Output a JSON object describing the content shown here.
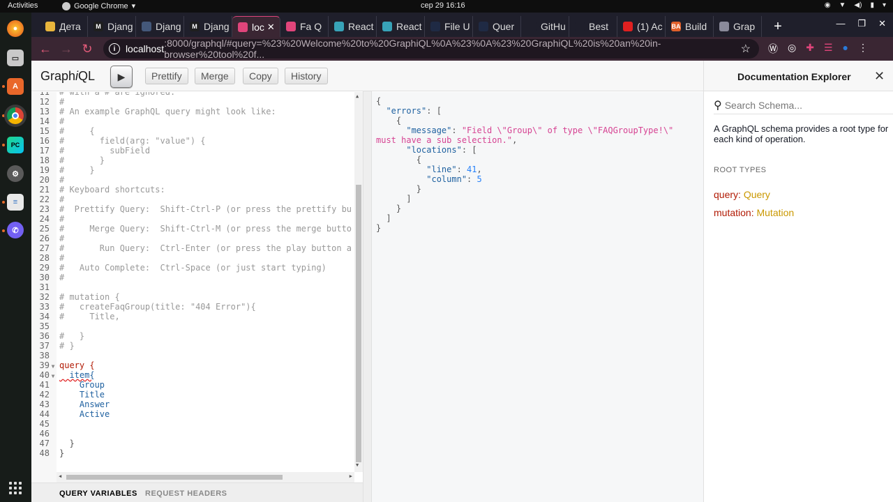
{
  "system": {
    "activities": "Activities",
    "app": "Google Chrome",
    "clock": "сер 29  16:16"
  },
  "tabs": [
    {
      "label": "Дета",
      "color": "#e8b53c"
    },
    {
      "label": "Djang",
      "color": "#1f1f1f",
      "icon": "M"
    },
    {
      "label": "Djang",
      "color": "#44587a"
    },
    {
      "label": "Djang",
      "color": "#1f1f1f",
      "icon": "M"
    },
    {
      "label": "loc",
      "color": "#e0457b",
      "active": true
    },
    {
      "label": "Fa Q",
      "color": "#e0457b"
    },
    {
      "label": "React",
      "color": "#38a3b8"
    },
    {
      "label": "React",
      "color": "#38a3b8"
    },
    {
      "label": "File U",
      "color": "#1f2a44"
    },
    {
      "label": "Quer",
      "color": "#1f2a44"
    },
    {
      "label": "GitHu",
      "color": "#1f1f2b"
    },
    {
      "label": "Best",
      "color": "#1f1f2b"
    },
    {
      "label": "(1) Ac",
      "color": "#e02020"
    },
    {
      "label": "Build",
      "color": "#e0602a",
      "icon": "BA"
    },
    {
      "label": "Grap",
      "color": "#8a8a9a"
    }
  ],
  "url": {
    "host": "localhost",
    "path": ":8000/graphql/#query=%23%20Welcome%20to%20GraphiQL%0A%23%0A%23%20GraphiQL%20is%20an%20in-browser%20tool%20f..."
  },
  "graphiql": {
    "logo_pre": "Graph",
    "logo_i": "i",
    "logo_post": "QL",
    "prettify": "Prettify",
    "merge": "Merge",
    "copy": "Copy",
    "history": "History",
    "query_variables": "QUERY VARIABLES",
    "request_headers": "REQUEST HEADERS"
  },
  "editor_lines": [
    {
      "n": "11",
      "t": "# with a # are ignored.",
      "c": "cm"
    },
    {
      "n": "12",
      "t": "#",
      "c": "cm"
    },
    {
      "n": "13",
      "t": "# An example GraphQL query might look like:",
      "c": "cm"
    },
    {
      "n": "14",
      "t": "#",
      "c": "cm"
    },
    {
      "n": "15",
      "t": "#     {",
      "c": "cm"
    },
    {
      "n": "16",
      "t": "#       field(arg: \"value\") {",
      "c": "cm"
    },
    {
      "n": "17",
      "t": "#         subField",
      "c": "cm"
    },
    {
      "n": "18",
      "t": "#       }",
      "c": "cm"
    },
    {
      "n": "19",
      "t": "#     }",
      "c": "cm"
    },
    {
      "n": "20",
      "t": "#",
      "c": "cm"
    },
    {
      "n": "21",
      "t": "# Keyboard shortcuts:",
      "c": "cm"
    },
    {
      "n": "22",
      "t": "#",
      "c": "cm"
    },
    {
      "n": "23",
      "t": "#  Prettify Query:  Shift-Ctrl-P (or press the prettify bu",
      "c": "cm"
    },
    {
      "n": "24",
      "t": "#",
      "c": "cm"
    },
    {
      "n": "25",
      "t": "#     Merge Query:  Shift-Ctrl-M (or press the merge butto",
      "c": "cm"
    },
    {
      "n": "26",
      "t": "#",
      "c": "cm"
    },
    {
      "n": "27",
      "t": "#       Run Query:  Ctrl-Enter (or press the play button a",
      "c": "cm"
    },
    {
      "n": "28",
      "t": "#",
      "c": "cm"
    },
    {
      "n": "29",
      "t": "#   Auto Complete:  Ctrl-Space (or just start typing)",
      "c": "cm"
    },
    {
      "n": "30",
      "t": "#",
      "c": "cm"
    },
    {
      "n": "31",
      "t": "",
      "c": "cm"
    },
    {
      "n": "32",
      "t": "# mutation {",
      "c": "cm"
    },
    {
      "n": "33",
      "t": "#   createFaqGroup(title: \"404 Error\"){",
      "c": "cm"
    },
    {
      "n": "34",
      "t": "#     Title,",
      "c": "cm"
    },
    {
      "n": "35",
      "t": "",
      "c": "cm"
    },
    {
      "n": "36",
      "t": "#   }",
      "c": "cm"
    },
    {
      "n": "37",
      "t": "# }",
      "c": "cm"
    },
    {
      "n": "38",
      "t": "",
      "c": "cm"
    },
    {
      "n": "39",
      "t": "query {",
      "c": "kw",
      "fold": true
    },
    {
      "n": "40",
      "t": "  item{",
      "c": "fld",
      "fold": true
    },
    {
      "n": "41",
      "t": "    Group",
      "c": "fld"
    },
    {
      "n": "42",
      "t": "    Title",
      "c": "fld"
    },
    {
      "n": "43",
      "t": "    Answer",
      "c": "fld"
    },
    {
      "n": "44",
      "t": "    Active",
      "c": "fld"
    },
    {
      "n": "45",
      "t": "",
      "c": "fld"
    },
    {
      "n": "46",
      "t": "",
      "c": "fld"
    },
    {
      "n": "47",
      "t": "  }",
      "c": "pun"
    },
    {
      "n": "48",
      "t": "}",
      "c": "pun"
    }
  ],
  "result_lines": [
    [
      {
        "t": "{",
        "c": "pun"
      }
    ],
    [
      {
        "t": "  \"errors\"",
        "c": "key"
      },
      {
        "t": ": [",
        "c": "pun"
      }
    ],
    [
      {
        "t": "    {",
        "c": "pun"
      }
    ],
    [
      {
        "t": "      \"message\"",
        "c": "key"
      },
      {
        "t": ": ",
        "c": "pun"
      },
      {
        "t": "\"Field \\\"Group\\\" of type \\\"FAQGroupType!\\\"",
        "c": "str"
      }
    ],
    [
      {
        "t": "must have a sub selection.\"",
        "c": "str"
      },
      {
        "t": ",",
        "c": "pun"
      }
    ],
    [
      {
        "t": "      \"locations\"",
        "c": "key"
      },
      {
        "t": ": [",
        "c": "pun"
      }
    ],
    [
      {
        "t": "        {",
        "c": "pun"
      }
    ],
    [
      {
        "t": "          \"line\"",
        "c": "key"
      },
      {
        "t": ": ",
        "c": "pun"
      },
      {
        "t": "41",
        "c": "num"
      },
      {
        "t": ",",
        "c": "pun"
      }
    ],
    [
      {
        "t": "          \"column\"",
        "c": "key"
      },
      {
        "t": ": ",
        "c": "pun"
      },
      {
        "t": "5",
        "c": "num"
      }
    ],
    [
      {
        "t": "        }",
        "c": "pun"
      }
    ],
    [
      {
        "t": "      ]",
        "c": "pun"
      }
    ],
    [
      {
        "t": "    }",
        "c": "pun"
      }
    ],
    [
      {
        "t": "  ]",
        "c": "pun"
      }
    ],
    [
      {
        "t": "}",
        "c": "pun"
      }
    ]
  ],
  "docs": {
    "title": "Documentation Explorer",
    "search_placeholder": "Search Schema...",
    "description": "A GraphQL schema provides a root type for each kind of operation.",
    "root_types_label": "ROOT TYPES",
    "root_types": [
      {
        "key": "query",
        "type": "Query"
      },
      {
        "key": "mutation",
        "type": "Mutation"
      }
    ]
  }
}
